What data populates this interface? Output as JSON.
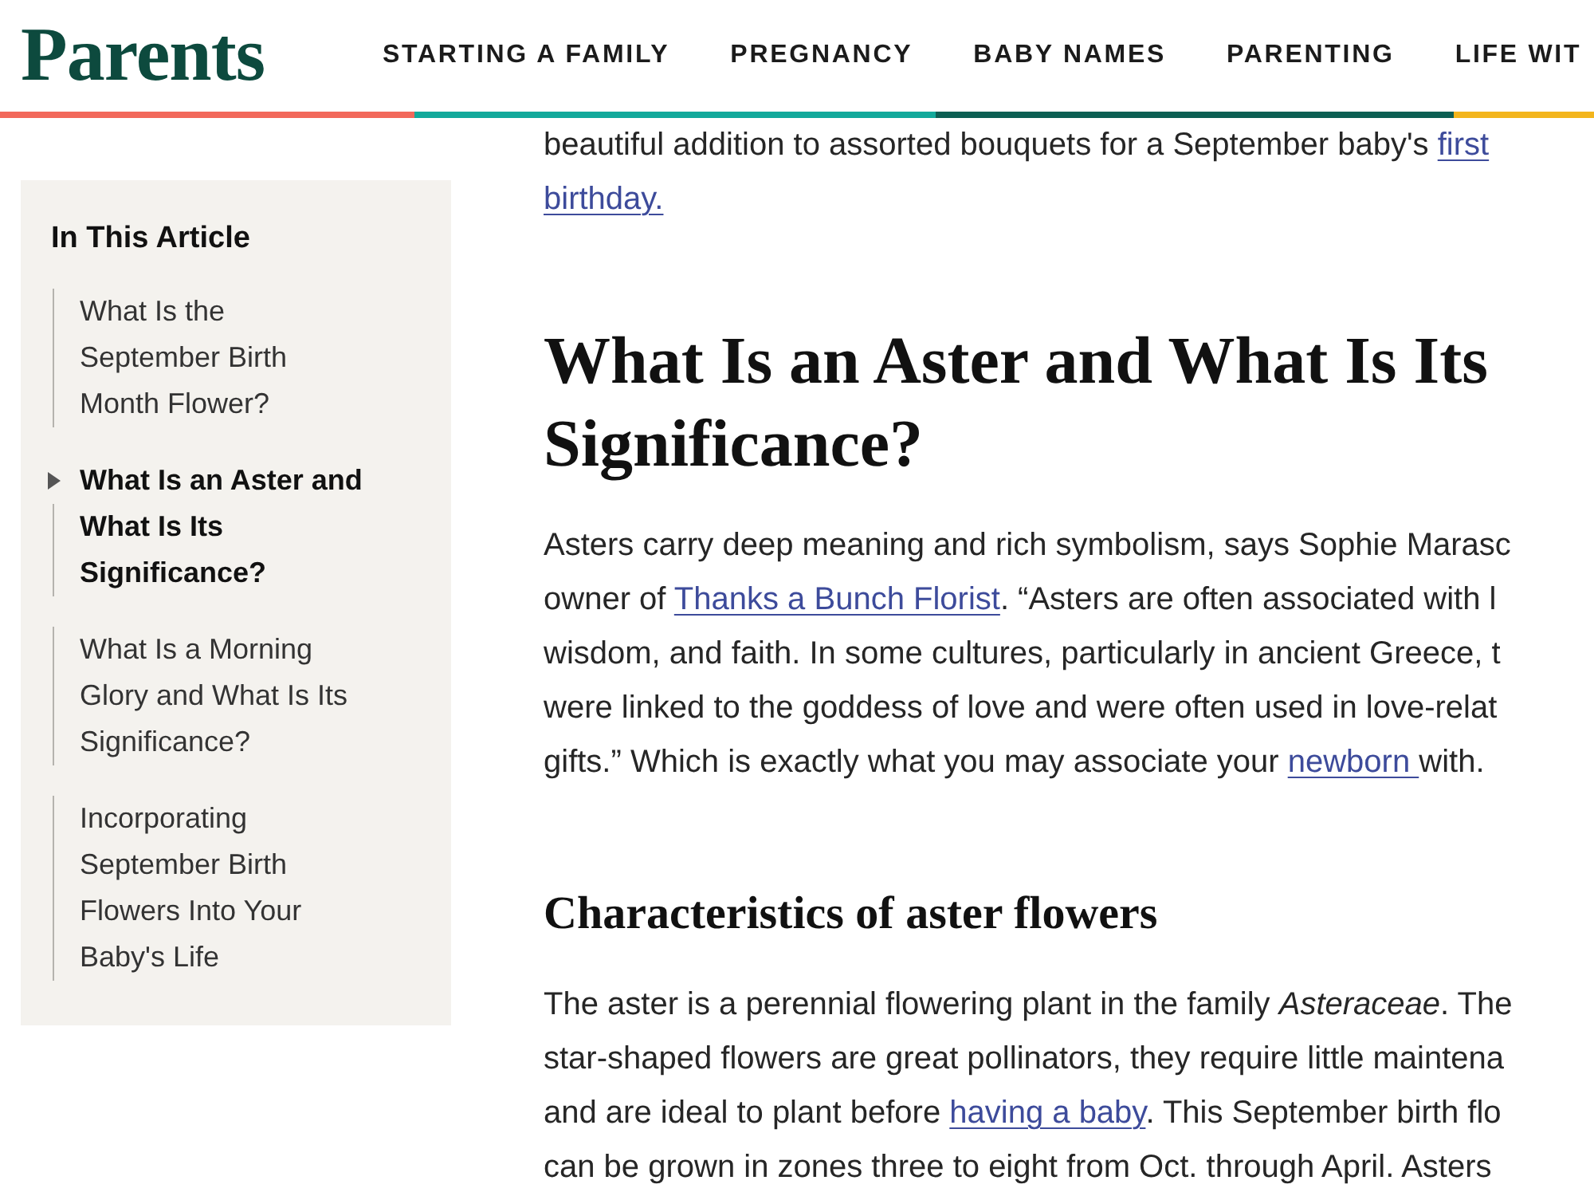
{
  "header": {
    "logo": "Parents",
    "nav": [
      "STARTING A FAMILY",
      "PREGNANCY",
      "BABY NAMES",
      "PARENTING",
      "LIFE WIT"
    ]
  },
  "sidebar": {
    "title": "In This Article",
    "items": [
      {
        "label": "What Is the September Birth Month Flower?",
        "selected": false
      },
      {
        "label": "What Is an Aster and What Is Its Significance?",
        "selected": true
      },
      {
        "label": "What Is a Morning Glory and What Is Its Significance?",
        "selected": false
      },
      {
        "label": "Incorporating September Birth Flowers Into Your Baby's Life",
        "selected": false
      }
    ]
  },
  "article": {
    "blocks": [
      {
        "kind": "paragraph",
        "lines": [
          [
            {
              "kind": "text",
              "text": "beautiful addition to assorted bouquets for a September baby's "
            },
            {
              "kind": "link",
              "text": "first"
            }
          ],
          [
            {
              "kind": "link",
              "text": "birthday."
            }
          ]
        ]
      },
      {
        "kind": "heading",
        "text": "What Is an Aster and What Is Its Significance?"
      },
      {
        "kind": "paragraph",
        "lines": [
          [
            {
              "kind": "text",
              "text": "Asters carry deep meaning and rich symbolism, says Sophie Marasc"
            }
          ],
          [
            {
              "kind": "text",
              "text": "owner of "
            },
            {
              "kind": "link",
              "text": "Thanks a Bunch Florist"
            },
            {
              "kind": "text",
              "text": ". “Asters are often associated with l"
            }
          ],
          [
            {
              "kind": "text",
              "text": "wisdom, and faith. In some cultures, particularly in ancient Greece, t"
            }
          ],
          [
            {
              "kind": "text",
              "text": "were linked to the goddess of love and were often used in love-relat"
            }
          ],
          [
            {
              "kind": "text",
              "text": "gifts.” Which is exactly what you may associate your "
            },
            {
              "kind": "link",
              "text": "newborn "
            },
            {
              "kind": "text",
              "text": "with."
            }
          ]
        ]
      },
      {
        "kind": "subheading",
        "text": "Characteristics of aster flowers"
      },
      {
        "kind": "paragraph",
        "lines": [
          [
            {
              "kind": "text",
              "text": "The aster is a perennial flowering plant in the family *Asteraceae*. The"
            }
          ],
          [
            {
              "kind": "text",
              "text": "star-shaped flowers are great pollinators, they require little maintena"
            }
          ],
          [
            {
              "kind": "text",
              "text": "and are ideal to plant before "
            },
            {
              "kind": "link",
              "text": "having a baby"
            },
            {
              "kind": "text",
              "text": ". This September birth flo"
            }
          ],
          [
            {
              "kind": "text",
              "text": "can be grown in zones three to eight from Oct. through April. Asters"
            }
          ]
        ]
      }
    ]
  }
}
